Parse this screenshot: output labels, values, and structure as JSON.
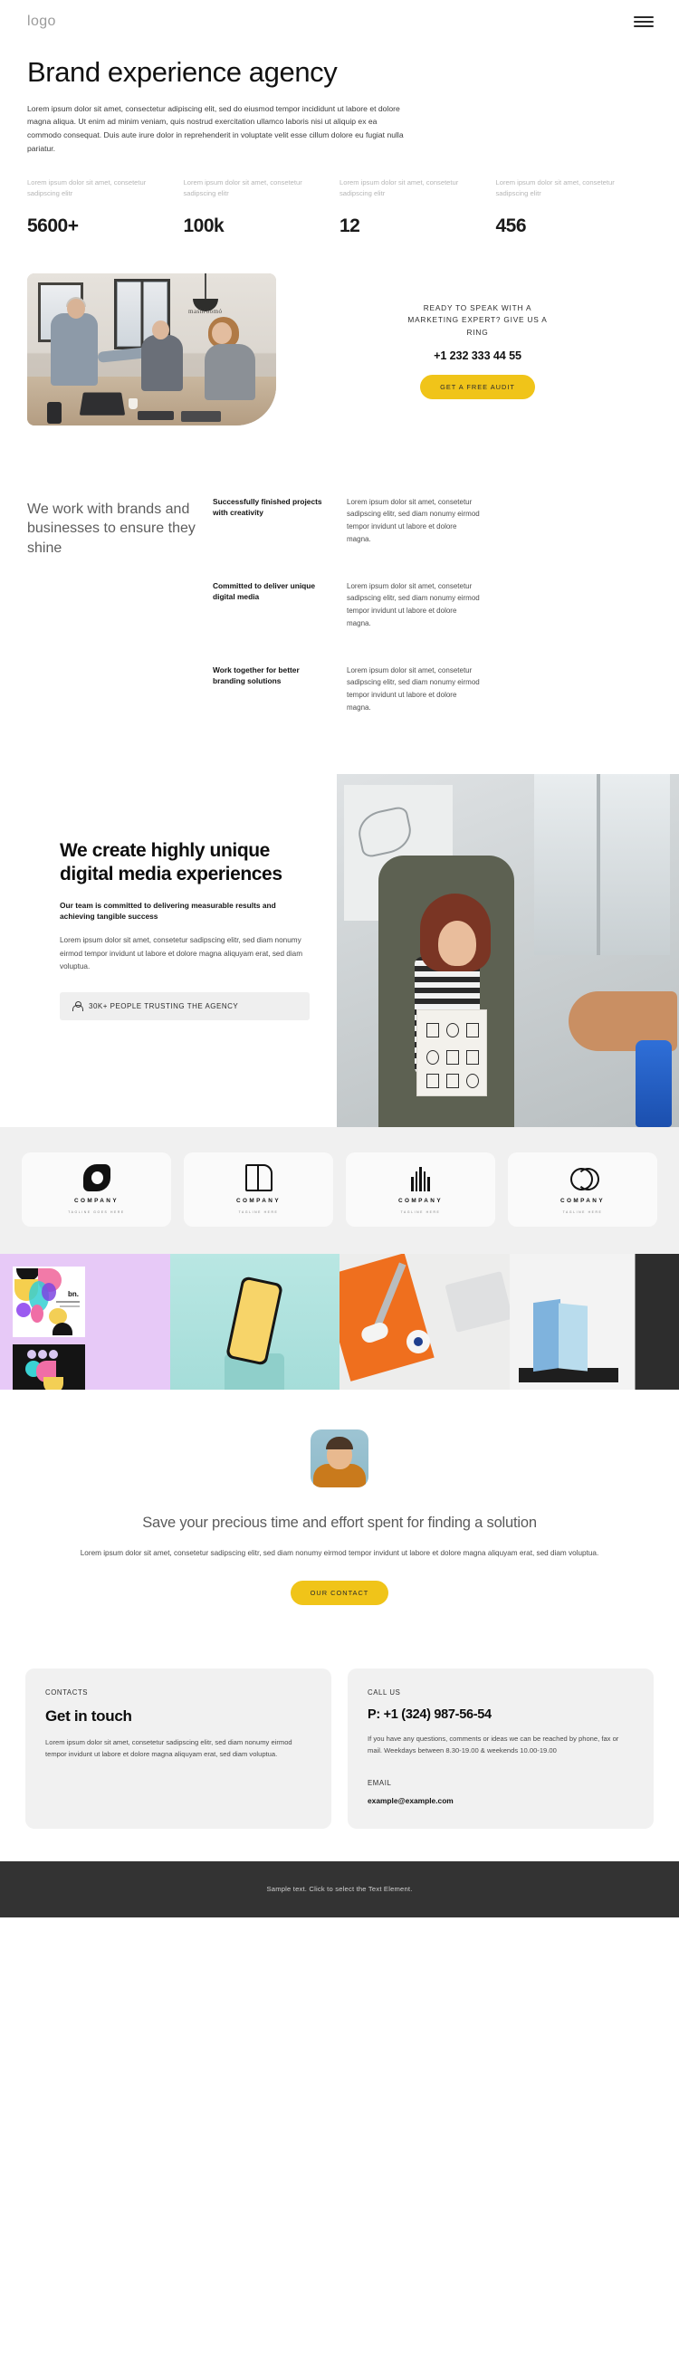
{
  "header": {
    "logo": "logo",
    "menu_icon": "hamburger-menu-icon"
  },
  "hero": {
    "title": "Brand experience agency",
    "lead": "Lorem ipsum dolor sit amet, consectetur adipiscing elit, sed do eiusmod tempor incididunt ut labore et dolore magna aliqua. Ut enim ad minim veniam, quis nostrud exercitation ullamco laboris nisi ut aliquip ex ea commodo consequat. Duis aute irure dolor in reprehenderit in voluptate velit esse cillum dolore eu fugiat nulla pariatur."
  },
  "stats": [
    {
      "label": "Lorem ipsum dolor sit amet, consetetur sadipscing elitr",
      "value": "5600+"
    },
    {
      "label": "Lorem ipsum dolor sit amet, consetetur sadipscing elitr",
      "value": "100k"
    },
    {
      "label": "Lorem ipsum dolor sit amet, consetetur sadipscing elitr",
      "value": "12"
    },
    {
      "label": "Lorem ipsum dolor sit amet, consetetur sadipscing elitr",
      "value": "456"
    }
  ],
  "cta": {
    "title": "READY TO SPEAK WITH A MARKETING EXPERT? GIVE US A RING",
    "phone": "+1 232 333 44 55",
    "button": "GET A FREE AUDIT",
    "button_color": "#f0c419",
    "photo_sign_text": "mashroomó"
  },
  "work_with": {
    "heading": "We work with brands and businesses to ensure they shine",
    "rows": [
      {
        "title": "Successfully finished projects with creativity",
        "text": "Lorem ipsum dolor sit amet, consetetur sadipscing elitr, sed diam nonumy eirmod tempor invidunt ut labore et dolore magna."
      },
      {
        "title": "Committed to deliver unique digital media",
        "text": "Lorem ipsum dolor sit amet, consetetur sadipscing elitr, sed diam nonumy eirmod tempor invidunt ut labore et dolore magna."
      },
      {
        "title": "Work together for better branding solutions",
        "text": "Lorem ipsum dolor sit amet, consetetur sadipscing elitr, sed diam nonumy eirmod tempor invidunt ut labore et dolore magna."
      }
    ]
  },
  "create": {
    "title": "We create highly unique digital media experiences",
    "subtitle": "Our team is committed to delivering measurable results and achieving tangible success",
    "body": "Lorem ipsum dolor sit amet, consetetur sadipscing elitr, sed diam nonumy eirmod tempor invidunt ut labore et dolore magna aliquyam erat, sed diam voluptua.",
    "trust_badge": "30K+ PEOPLE TRUSTING THE AGENCY",
    "trust_icon": "person-icon"
  },
  "logos": [
    {
      "name": "COMPANY",
      "tagline": "TAGLINE GOES HERE",
      "mark": "infinity-ring-mark"
    },
    {
      "name": "COMPANY",
      "tagline": "TAGLINE HERE",
      "mark": "open-book-mark"
    },
    {
      "name": "COMPANY",
      "tagline": "TAGLINE HERE",
      "mark": "wave-lines-mark"
    },
    {
      "name": "COMPANY",
      "tagline": "TAGLINE HERE",
      "mark": "double-circle-mark"
    }
  ],
  "gallery": [
    {
      "caption": "bn.",
      "sub1": "NAME SURNAME",
      "sub2": "PROFESSION",
      "name": "branding-cards-image",
      "bg": "#e7c9f7"
    },
    {
      "name": "phone-mockup-image",
      "bg": "#b9e7e3"
    },
    {
      "name": "desk-stationery-image",
      "bg": "#ededec"
    },
    {
      "name": "paper-cards-image",
      "bg": "#f3f3f3"
    }
  ],
  "save_time": {
    "avatar_alt": "testimonial-avatar",
    "title": "Save your precious time and effort spent for finding a solution",
    "body": "Lorem ipsum dolor sit amet, consetetur sadipscing elitr, sed diam nonumy eirmod tempor invidunt ut labore et dolore magna aliquyam erat, sed diam voluptua.",
    "button": "OUR CONTACT"
  },
  "contacts": {
    "left": {
      "eyebrow": "CONTACTS",
      "title": "Get in touch",
      "text": "Lorem ipsum dolor sit amet, consetetur sadipscing elitr, sed diam nonumy eirmod tempor invidunt ut labore et dolore magna aliquyam erat, sed diam voluptua."
    },
    "right": {
      "eyebrow": "CALL US",
      "phone": "P: +1 (324) 987-56-54",
      "text": "If you have any questions, comments or ideas we can be reached by phone, fax or mail. Weekdays between 8.30-19.00 & weekends 10.00-19.00",
      "email_label": "EMAIL",
      "email": "example@example.com"
    }
  },
  "footer": {
    "text": "Sample text. Click to select the Text Element."
  }
}
